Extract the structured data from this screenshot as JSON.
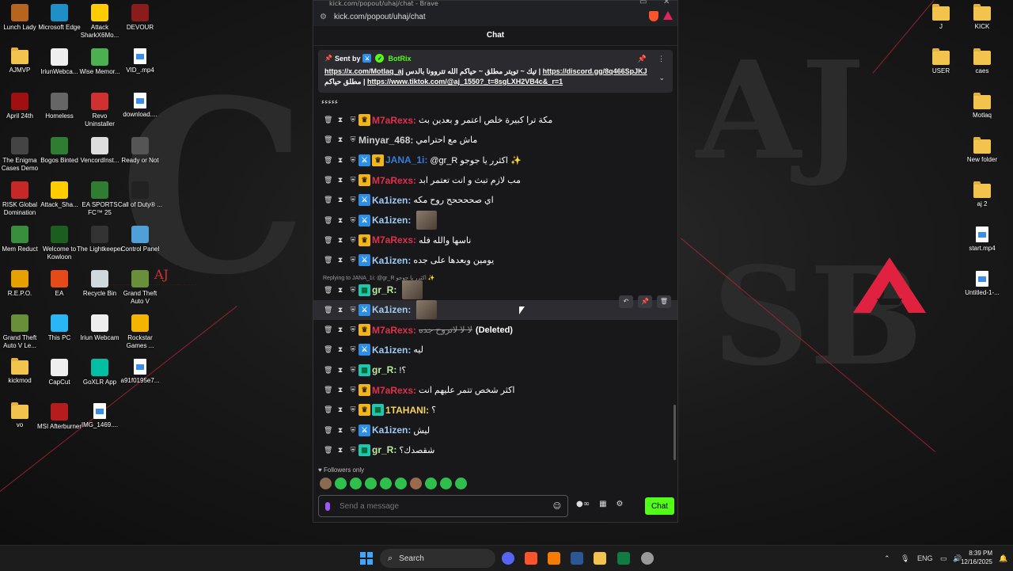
{
  "desktop": {
    "left_icons": [
      {
        "label": "Lunch Lady",
        "color": "#b5651d"
      },
      {
        "label": "Microsoft Edge",
        "color": "#1e90c8"
      },
      {
        "label": "Attack SharkX6Mo...",
        "color": "#ffcc00"
      },
      {
        "label": "DEVOUR",
        "color": "#8b1c1c"
      },
      {
        "label": "AJMVP",
        "color": "folder"
      },
      {
        "label": "IriunWebca...",
        "color": "#eeeeee"
      },
      {
        "label": "Wise Memor...",
        "color": "#4caf50"
      },
      {
        "label": "VID_.mp4",
        "color": "file"
      },
      {
        "label": "April 24th",
        "color": "#a01010"
      },
      {
        "label": "Homeless",
        "color": "#666666"
      },
      {
        "label": "Revo Uninstaller",
        "color": "#d03030"
      },
      {
        "label": "download....",
        "color": "file"
      },
      {
        "label": "The Enigma Cases Demo",
        "color": "#444444"
      },
      {
        "label": "Bogos Binted",
        "color": "#2e7d32"
      },
      {
        "label": "VencordInst...",
        "color": "#dddddd"
      },
      {
        "label": "Ready or Not",
        "color": "#555555"
      },
      {
        "label": "RISK Global Domination",
        "color": "#c62828"
      },
      {
        "label": "Attack_Sha...",
        "color": "#ffcc00"
      },
      {
        "label": "EA SPORTS FC™ 25",
        "color": "#2e7d32"
      },
      {
        "label": "Call of Duty® ...",
        "color": "#222222"
      },
      {
        "label": "Mem Reduct",
        "color": "#388e3c"
      },
      {
        "label": "Welcome to Kowloon",
        "color": "#1b5e20"
      },
      {
        "label": "The Lightkeeper",
        "color": "#333333"
      },
      {
        "label": "Control Panel",
        "color": "#4f9fd8"
      },
      {
        "label": "R.E.P.O.",
        "color": "#e6a000"
      },
      {
        "label": "EA",
        "color": "#e64a19"
      },
      {
        "label": "Recycle Bin",
        "color": "#cfd8dc"
      },
      {
        "label": "Grand Theft Auto V",
        "color": "#6a8f3a"
      },
      {
        "label": "Grand Theft Auto V Le...",
        "color": "#6a8f3a"
      },
      {
        "label": "This PC",
        "color": "#29b6f6"
      },
      {
        "label": "Iriun Webcam",
        "color": "#eeeeee"
      },
      {
        "label": "Rockstar Games ...",
        "color": "#f4b400"
      },
      {
        "label": "kickmod",
        "color": "folder"
      },
      {
        "label": "CapCut",
        "color": "#eeeeee"
      },
      {
        "label": "GoXLR App",
        "color": "#00bfa5"
      },
      {
        "label": "a91f0195e7...",
        "color": "file"
      },
      {
        "label": "vo",
        "color": "folder"
      },
      {
        "label": "MSI Afterburner",
        "color": "#b71c1c"
      },
      {
        "label": "IMG_1469....",
        "color": "file"
      }
    ],
    "right_icons": [
      {
        "label": "J",
        "color": "folder"
      },
      {
        "label": "KICK",
        "color": "folder"
      },
      {
        "label": "USER",
        "color": "folder"
      },
      {
        "label": "caes",
        "color": "folder"
      },
      {
        "label": "Motlaq",
        "color": "folder"
      },
      {
        "label": "New folder",
        "color": "folder"
      },
      {
        "label": "aj 2",
        "color": "folder"
      },
      {
        "label": "start.mp4",
        "color": "file"
      },
      {
        "label": "Untitled-1-...",
        "color": "file"
      }
    ],
    "aj_text": "AJ"
  },
  "browser": {
    "title": "kick.com/popout/uhaj/chat - Brave",
    "url": "kick.com/popout/uhaj/chat"
  },
  "chat": {
    "header": "Chat",
    "pinned": {
      "sent_by_label": "Sent by",
      "sender": "BotRix",
      "line1_text": "تيك ~ تويتر مطلق ~ حياكم الله تتروونا بالدس |",
      "line1_link1": "https://x.com/Motlaq_aj",
      "line1_link2": "https://discord.gg/8q466SpJKJ",
      "line2_text": "مطلق حياكم |",
      "line2_link": "https://www.tiktok.com/@aj_1550?_t=8sgLXH2VB4c&_r=1"
    },
    "cut_text": "ﺀﺀﺀﺀﺀ",
    "reply_hint": "Replying to JANA_1i: @gr_R اكثرر يا جوجو ✨",
    "messages": [
      {
        "badges": [
          "crown"
        ],
        "user": "M7aRexs",
        "color": "#e0304a",
        "text": "مكة ترا كبيرة خلص اعتمر و بعدين بث"
      },
      {
        "badges": [],
        "user": "Minyar_468",
        "color": "#d0d0d0",
        "text": "ماش مع احترامي"
      },
      {
        "badges": [
          "sword",
          "crown"
        ],
        "user": "JANA_1i",
        "color": "#3a7bd5",
        "text": "@gr_R اكثرر يا جوجو ✨"
      },
      {
        "badges": [
          "crown"
        ],
        "user": "M7aRexs",
        "color": "#e0304a",
        "text": "مب لازم تبث و انت تعتمر ابد"
      },
      {
        "badges": [
          "sword"
        ],
        "user": "Ka1izen",
        "color": "#9ecbf5",
        "text": "اي صححححح روح مكه"
      },
      {
        "badges": [
          "sword"
        ],
        "user": "Ka1izen",
        "color": "#9ecbf5",
        "text": "",
        "emote": true
      },
      {
        "badges": [
          "crown"
        ],
        "user": "M7aRexs",
        "color": "#e0304a",
        "text": "ناسها والله فله"
      },
      {
        "badges": [
          "sword"
        ],
        "user": "Ka1izen",
        "color": "#9ecbf5",
        "text": "يومين وبعدها على جده"
      },
      {
        "badges": [
          "sub"
        ],
        "user": "gr_R",
        "color": "#bde8a0",
        "text": "",
        "emote": true
      },
      {
        "badges": [
          "sword"
        ],
        "user": "Ka1izen",
        "color": "#9ecbf5",
        "text": "",
        "emote": true,
        "highlight": true
      },
      {
        "badges": [
          "crown"
        ],
        "user": "M7aRexs",
        "color": "#e0304a",
        "text": "لا لا لاتروح جده",
        "deleted": true
      },
      {
        "badges": [
          "sword"
        ],
        "user": "Ka1izen",
        "color": "#9ecbf5",
        "text": "ليه"
      },
      {
        "badges": [
          "sub"
        ],
        "user": "gr_R",
        "color": "#bde8a0",
        "text": "!؟"
      },
      {
        "badges": [
          "crown"
        ],
        "user": "M7aRexs",
        "color": "#e0304a",
        "text": "اكثر شخص تتمر عليهم انت"
      },
      {
        "badges": [
          "crown",
          "sub"
        ],
        "user": "1TAHANI",
        "color": "#f4d35e",
        "text": "؟"
      },
      {
        "badges": [
          "sword"
        ],
        "user": "Ka1izen",
        "color": "#9ecbf5",
        "text": "ليش"
      },
      {
        "badges": [
          "sub"
        ],
        "user": "gr_R",
        "color": "#bde8a0",
        "text": "شقصدك؟"
      }
    ],
    "deleted_label": "(Deleted)",
    "followers_only": "Followers only",
    "input_placeholder": "Send a message",
    "chat_button": "Chat"
  },
  "taskbar": {
    "search_label": "Search",
    "lang": "ENG",
    "time": "8:39 PM",
    "date": "12/16/2025"
  }
}
